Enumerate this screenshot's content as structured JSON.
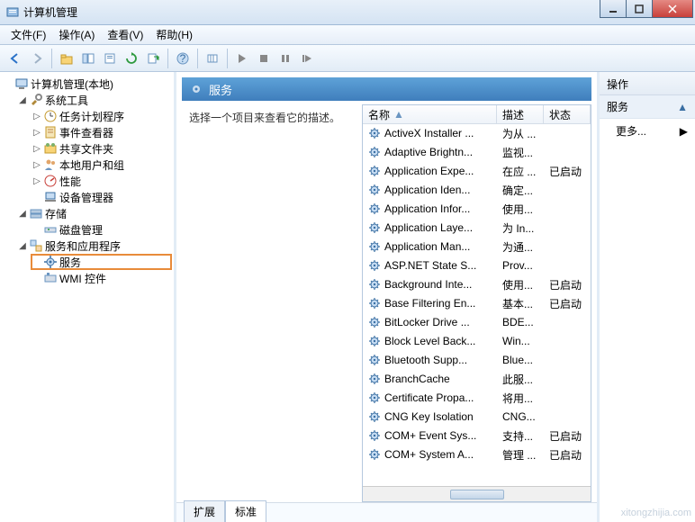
{
  "window": {
    "title": "计算机管理"
  },
  "menu": {
    "file": "文件(F)",
    "action": "操作(A)",
    "view": "查看(V)",
    "help": "帮助(H)"
  },
  "tree": {
    "root": "计算机管理(本地)",
    "system_tools": "系统工具",
    "task_scheduler": "任务计划程序",
    "event_viewer": "事件查看器",
    "shared_folders": "共享文件夹",
    "local_users": "本地用户和组",
    "performance": "性能",
    "device_manager": "设备管理器",
    "storage": "存储",
    "disk_management": "磁盘管理",
    "services_apps": "服务和应用程序",
    "services": "服务",
    "wmi_control": "WMI 控件"
  },
  "center": {
    "title": "服务",
    "hint": "选择一个项目来查看它的描述。",
    "columns": {
      "name": "名称",
      "desc": "描述",
      "status": "状态"
    },
    "tabs": {
      "extended": "扩展",
      "standard": "标准"
    }
  },
  "services": [
    {
      "name": "ActiveX Installer ...",
      "desc": "为从 ...",
      "status": ""
    },
    {
      "name": "Adaptive Brightn...",
      "desc": "监视...",
      "status": ""
    },
    {
      "name": "Application Expe...",
      "desc": "在应 ...",
      "status": "已启动"
    },
    {
      "name": "Application Iden...",
      "desc": "确定...",
      "status": ""
    },
    {
      "name": "Application Infor...",
      "desc": "使用...",
      "status": ""
    },
    {
      "name": "Application Laye...",
      "desc": "为 In...",
      "status": ""
    },
    {
      "name": "Application Man...",
      "desc": "为通...",
      "status": ""
    },
    {
      "name": "ASP.NET State S...",
      "desc": "Prov...",
      "status": ""
    },
    {
      "name": "Background Inte...",
      "desc": "使用...",
      "status": "已启动"
    },
    {
      "name": "Base Filtering En...",
      "desc": "基本...",
      "status": "已启动"
    },
    {
      "name": "BitLocker Drive ...",
      "desc": "BDE...",
      "status": ""
    },
    {
      "name": "Block Level Back...",
      "desc": "Win...",
      "status": ""
    },
    {
      "name": "Bluetooth Supp...",
      "desc": "Blue...",
      "status": ""
    },
    {
      "name": "BranchCache",
      "desc": "此服...",
      "status": ""
    },
    {
      "name": "Certificate Propa...",
      "desc": "将用...",
      "status": ""
    },
    {
      "name": "CNG Key Isolation",
      "desc": "CNG...",
      "status": ""
    },
    {
      "name": "COM+ Event Sys...",
      "desc": "支持...",
      "status": "已启动"
    },
    {
      "name": "COM+ System A...",
      "desc": "管理 ...",
      "status": "已启动"
    }
  ],
  "actions": {
    "header": "操作",
    "sub": "服务",
    "more": "更多..."
  },
  "watermark": "xitongzhijia.com"
}
